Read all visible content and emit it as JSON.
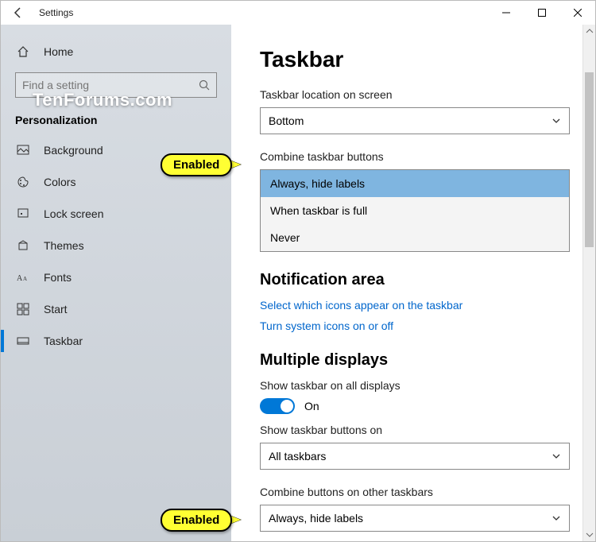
{
  "window": {
    "title": "Settings"
  },
  "watermark": "TenForums.com",
  "sidebar": {
    "home": "Home",
    "search_placeholder": "Find a setting",
    "section": "Personalization",
    "items": [
      {
        "label": "Background"
      },
      {
        "label": "Colors"
      },
      {
        "label": "Lock screen"
      },
      {
        "label": "Themes"
      },
      {
        "label": "Fonts"
      },
      {
        "label": "Start"
      },
      {
        "label": "Taskbar"
      }
    ]
  },
  "main": {
    "title": "Taskbar",
    "location_label": "Taskbar location on screen",
    "location_value": "Bottom",
    "combine_label": "Combine taskbar buttons",
    "combine_options": [
      "Always, hide labels",
      "When taskbar is full",
      "Never"
    ],
    "notification_heading": "Notification area",
    "link_icons": "Select which icons appear on the taskbar",
    "link_system_icons": "Turn system icons on or off",
    "multi_heading": "Multiple displays",
    "show_all_label": "Show taskbar on all displays",
    "show_all_state": "On",
    "show_on_label": "Show taskbar buttons on",
    "show_on_value": "All taskbars",
    "combine_other_label": "Combine buttons on other taskbars",
    "combine_other_value": "Always, hide labels"
  },
  "callouts": {
    "enabled1": "Enabled",
    "enabled2": "Enabled"
  }
}
